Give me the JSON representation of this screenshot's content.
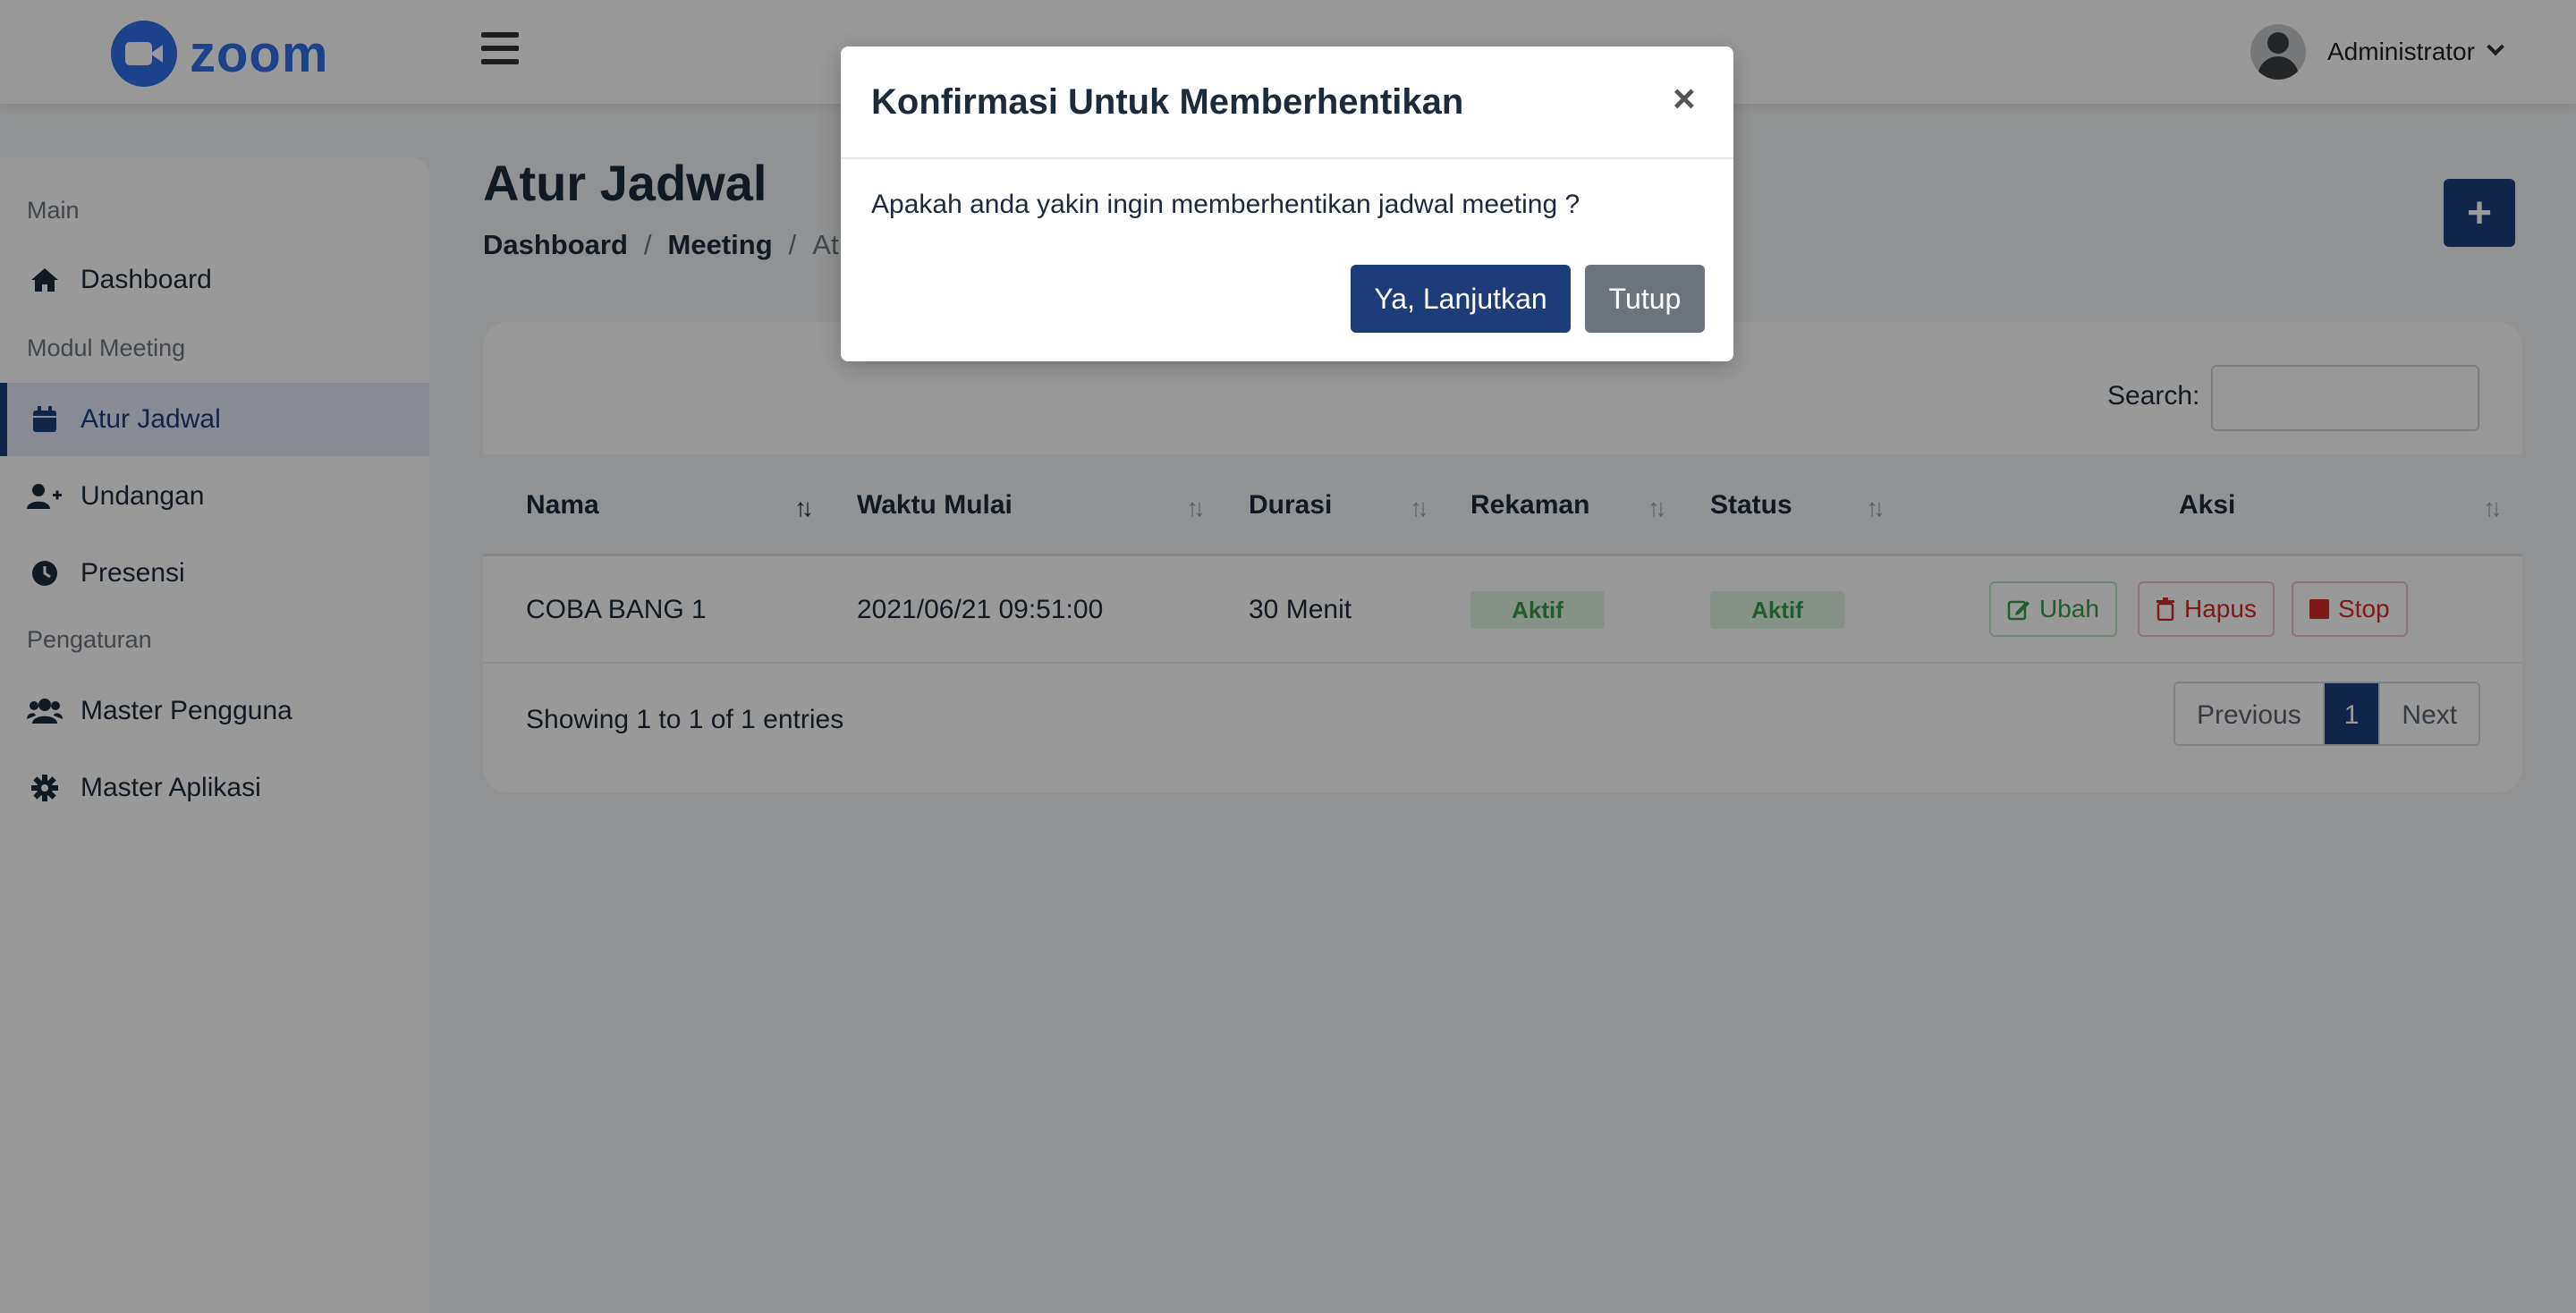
{
  "brand": {
    "logo_text": "zoom",
    "logo_color": "#2d6ee8"
  },
  "header": {
    "user_name": "Administrator"
  },
  "sidebar": {
    "sections": [
      "Main",
      "Modul Meeting",
      "Pengaturan"
    ],
    "items": [
      {
        "label": "Dashboard",
        "icon": "home-icon"
      },
      {
        "label": "Atur Jadwal",
        "icon": "calendar-icon",
        "active": true
      },
      {
        "label": "Undangan",
        "icon": "user-plus-icon"
      },
      {
        "label": "Presensi",
        "icon": "clock-icon"
      },
      {
        "label": "Master Pengguna",
        "icon": "users-icon"
      },
      {
        "label": "Master Aplikasi",
        "icon": "gear-icon"
      }
    ]
  },
  "page": {
    "title": "Atur Jadwal",
    "breadcrumb": [
      "Dashboard",
      "Meeting",
      "At"
    ],
    "breadcrumb_sep": "/",
    "add_label": "+"
  },
  "table": {
    "search_label": "Search:",
    "search_value": "",
    "columns": [
      "Nama",
      "Waktu Mulai",
      "Durasi",
      "Rekaman",
      "Status",
      "Aksi"
    ],
    "rows": [
      {
        "nama": "COBA BANG 1",
        "waktu_mulai": "2021/06/21 09:51:00",
        "durasi": "30 Menit",
        "rekaman": "Aktif",
        "status": "Aktif"
      }
    ],
    "actions": {
      "edit": "Ubah",
      "delete": "Hapus",
      "stop": "Stop"
    },
    "info": "Showing 1 to 1 of 1 entries",
    "pagination": {
      "previous": "Previous",
      "current": "1",
      "next": "Next"
    }
  },
  "modal": {
    "title": "Konfirmasi Untuk Memberhentikan",
    "close_symbol": "×",
    "message": "Apakah anda yakin ingin memberhentikan jadwal meeting ?",
    "confirm_label": "Ya, Lanjutkan",
    "cancel_label": "Tutup"
  },
  "colors": {
    "primary": "#1d3d7a",
    "success": "#3a9a4a",
    "danger": "#d02b2b",
    "secondary": "#6c757d"
  }
}
